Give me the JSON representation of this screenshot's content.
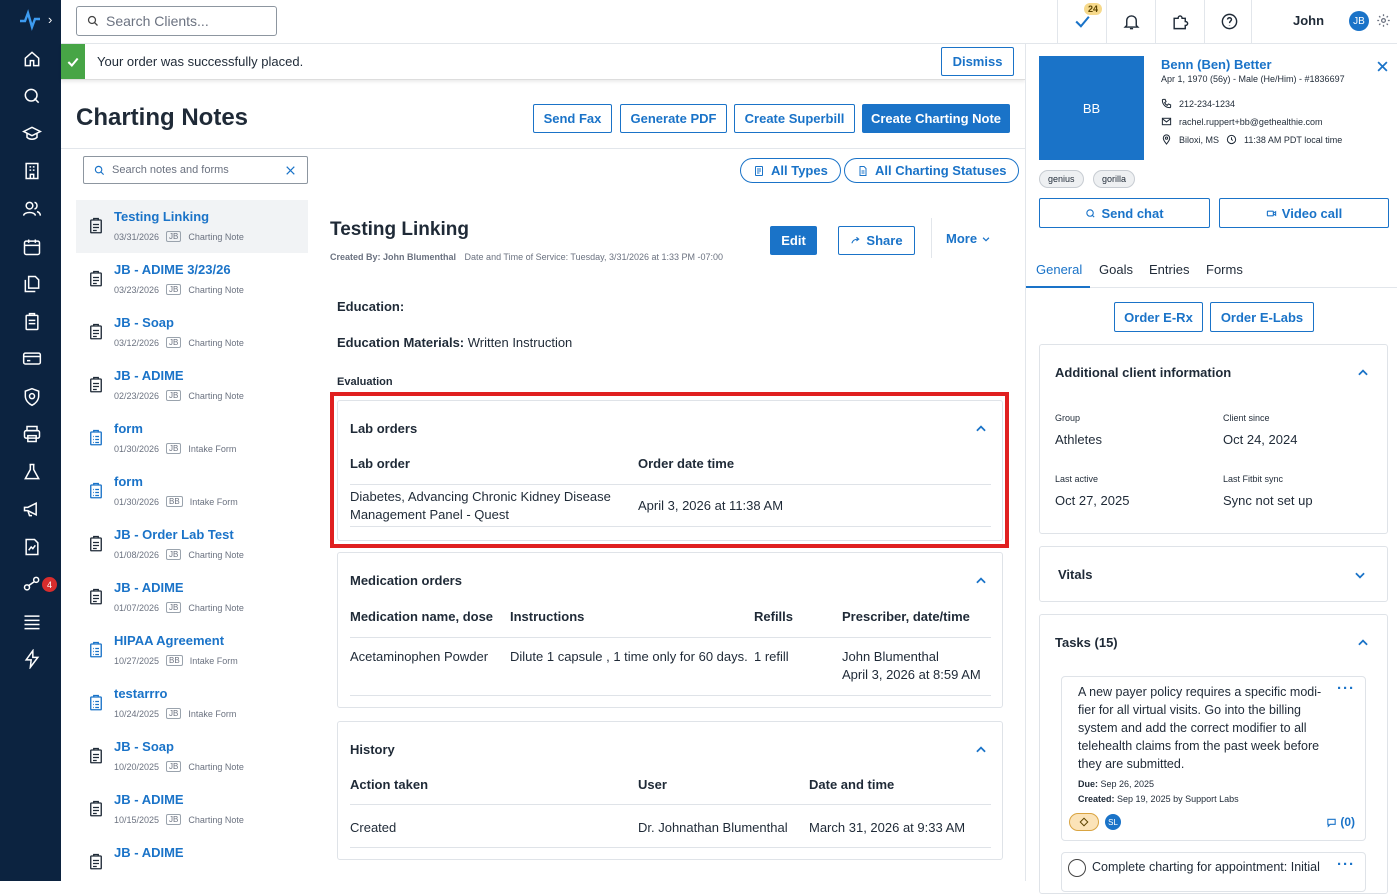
{
  "topbar": {
    "search_placeholder": "Search Clients...",
    "tasks_badge": "24",
    "user_name": "John",
    "user_initials": "JB"
  },
  "sidebar": {
    "badge_count": "4"
  },
  "alert": {
    "message": "Your order was successfully placed.",
    "dismiss_label": "Dismiss"
  },
  "header": {
    "title": "Charting Notes",
    "send_fax": "Send Fax",
    "generate_pdf": "Generate PDF",
    "create_superbill": "Create Superbill",
    "create_charting_note": "Create Charting Note"
  },
  "filters": {
    "search_placeholder": "Search notes and forms",
    "all_types": "All Types",
    "all_statuses": "All Charting Statuses"
  },
  "notes": [
    {
      "title": "Testing Linking",
      "date": "03/31/2026",
      "initials": "JB",
      "type": "Charting Note"
    },
    {
      "title": "JB - ADIME 3/23/26",
      "date": "03/23/2026",
      "initials": "JB",
      "type": "Charting Note"
    },
    {
      "title": "JB - Soap",
      "date": "03/12/2026",
      "initials": "JB",
      "type": "Charting Note"
    },
    {
      "title": "JB - ADIME",
      "date": "02/23/2026",
      "initials": "JB",
      "type": "Charting Note"
    },
    {
      "title": "form",
      "date": "01/30/2026",
      "initials": "JB",
      "type": "Intake Form"
    },
    {
      "title": "form",
      "date": "01/30/2026",
      "initials": "BB",
      "type": "Intake Form"
    },
    {
      "title": "JB - Order Lab Test",
      "date": "01/08/2026",
      "initials": "JB",
      "type": "Charting Note"
    },
    {
      "title": "JB - ADIME",
      "date": "01/07/2026",
      "initials": "JB",
      "type": "Charting Note"
    },
    {
      "title": "HIPAA Agreement",
      "date": "10/27/2025",
      "initials": "BB",
      "type": "Intake Form"
    },
    {
      "title": "testarrro",
      "date": "10/24/2025",
      "initials": "JB",
      "type": "Intake Form"
    },
    {
      "title": "JB - Soap",
      "date": "10/20/2025",
      "initials": "JB",
      "type": "Charting Note"
    },
    {
      "title": "JB - ADIME",
      "date": "10/15/2025",
      "initials": "JB",
      "type": "Charting Note"
    },
    {
      "title": "JB - ADIME",
      "date": "",
      "initials": "",
      "type": ""
    }
  ],
  "note_detail": {
    "title": "Testing Linking",
    "created_by": "Created By: John Blumenthal",
    "service_time": "Date and Time of Service: Tuesday, 3/31/2026 at 1:33 PM -07:00",
    "edit": "Edit",
    "share": "Share",
    "more": "More",
    "education_label": "Education:",
    "education_materials_label": "Education Materials:",
    "education_materials_value": "Written Instruction",
    "evaluation_label": "Evaluation",
    "lab_orders": {
      "title": "Lab orders",
      "col_order": "Lab order",
      "col_date": "Order date time",
      "row_order_line1": "Diabetes, Advancing Chronic Kidney Disease",
      "row_order_line2": "Management Panel - Quest",
      "row_date": "April 3, 2026 at 11:38 AM"
    },
    "medication_orders": {
      "title": "Medication orders",
      "col_name": "Medication name, dose",
      "col_instructions": "Instructions",
      "col_refills": "Refills",
      "col_prescriber": "Prescriber, date/time",
      "row_name": "Acetaminophen Powder",
      "row_instructions": "Dilute 1 capsule , 1 time only for 60 days.",
      "row_refills": "1 refill",
      "row_prescriber": "John Blumenthal",
      "row_datetime": "April 3, 2026 at 8:59 AM"
    },
    "history": {
      "title": "History",
      "col_action": "Action taken",
      "col_user": "User",
      "col_datetime": "Date and time",
      "row_action": "Created",
      "row_user": "Dr. Johnathan Blumenthal",
      "row_datetime": "March 31, 2026 at 9:33 AM"
    }
  },
  "client": {
    "initials": "BB",
    "name": "Benn (Ben) Better",
    "details": "Apr 1, 1970 (56y) - Male (He/Him) - #1836697",
    "phone": "212-234-1234",
    "email": "rachel.ruppert+bb@gethealthie.com",
    "location": "Biloxi, MS",
    "local_time": "11:38 AM PDT local time",
    "tags": [
      "genius",
      "gorilla"
    ],
    "send_chat": "Send chat",
    "video_call": "Video call",
    "tabs": [
      "General",
      "Goals",
      "Entries",
      "Forms"
    ],
    "order_erx": "Order E-Rx",
    "order_elabs": "Order E-Labs",
    "additional_title": "Additional client information",
    "group_label": "Group",
    "group_value": "Athletes",
    "since_label": "Client since",
    "since_value": "Oct 24, 2024",
    "last_active_label": "Last active",
    "last_active_value": "Oct 27, 2025",
    "fitbit_label": "Last Fitbit sync",
    "fitbit_value": "Sync not set up",
    "vitals_title": "Vitals",
    "tasks_title": "Tasks (15)",
    "task1": {
      "lines": [
        "A new payer policy requires a specific modi-",
        "fier for all virtual visits. Go into the billing",
        "system and add the correct modifier to all",
        "telehealth claims from the past week before",
        "they are submitted."
      ],
      "due_label": "Due:",
      "due": "Sep 26, 2025",
      "created_label": "Created:",
      "created": "Sep 19, 2025 by Support Labs",
      "assignee": "SL",
      "comments": "(0)"
    },
    "task2": {
      "text": "Complete charting for appointment: Initial"
    }
  }
}
